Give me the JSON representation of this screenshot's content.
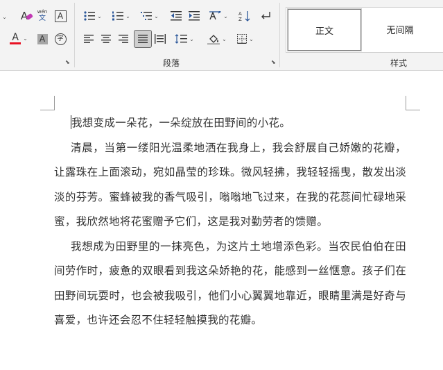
{
  "ribbon": {
    "paragraph_group_label": "段落",
    "styles_group_label": "样式",
    "styles": [
      "正文",
      "无间隔"
    ],
    "font_tools": {
      "phonetic_top": "wén",
      "phonetic_bottom": "文",
      "char_border": "A",
      "font_color": "A",
      "shading": "A",
      "enclose": "字",
      "clear_format": "A"
    },
    "colors": {
      "font_color_bar": "#e81123",
      "accent": "#2b579a"
    }
  },
  "document": {
    "paragraphs": [
      "我想变成一朵花，一朵绽放在田野间的小花。",
      "清晨，当第一缕阳光温柔地洒在我身上，我会舒展自己娇嫩的花瓣，让露珠在上面滚动，宛如晶莹的珍珠。微风轻拂，我轻轻摇曳，散发出淡淡的芬芳。蜜蜂被我的香气吸引，嗡嗡地飞过来，在我的花蕊间忙碌地采蜜，我欣然地将花蜜赠予它们，这是我对勤劳者的馈赠。",
      "我想成为田野里的一抹亮色，为这片土地增添色彩。当农民伯伯在田间劳作时，疲惫的双眼看到我这朵娇艳的花，能感到一丝惬意。孩子们在田野间玩耍时，也会被我吸引，他们小心翼翼地靠近，眼睛里满是好奇与喜爱，也许还会忍不住轻轻触摸我的花瓣。"
    ]
  }
}
